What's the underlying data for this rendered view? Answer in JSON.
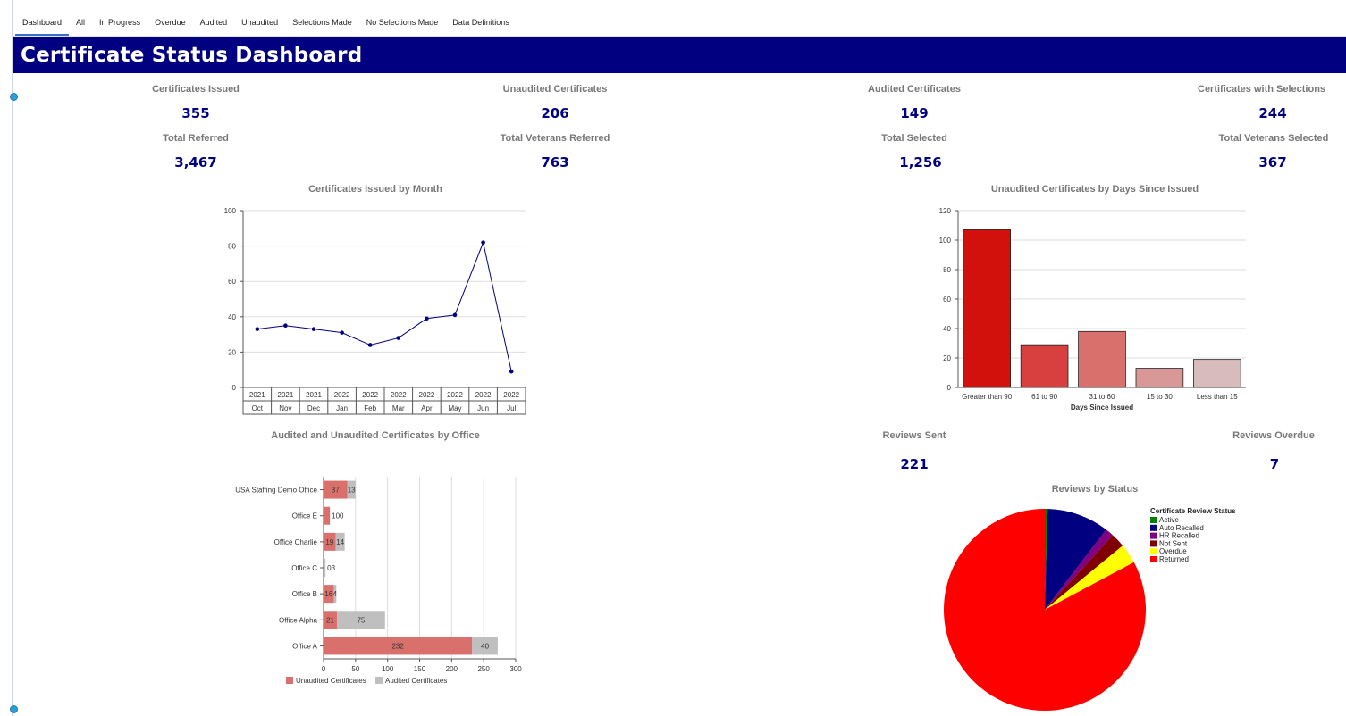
{
  "tabs": [
    "Dashboard",
    "All",
    "In Progress",
    "Overdue",
    "Audited",
    "Unaudited",
    "Selections Made",
    "No Selections Made",
    "Data Definitions"
  ],
  "banner": {
    "title": "Certificate Status Dashboard"
  },
  "kpis": {
    "certificates_issued": {
      "label": "Certificates Issued",
      "value": "355"
    },
    "unaudited_certificates": {
      "label": "Unaudited Certificates",
      "value": "206"
    },
    "audited_certificates": {
      "label": "Audited Certificates",
      "value": "149"
    },
    "certificates_with_selections": {
      "label": "Certificates with Selections",
      "value": "244"
    },
    "total_referred": {
      "label": "Total Referred",
      "value": "3,467"
    },
    "total_veterans_referred": {
      "label": "Total Veterans Referred",
      "value": "763"
    },
    "total_selected": {
      "label": "Total Selected",
      "value": "1,256"
    },
    "total_veterans_selected": {
      "label": "Total Veterans Selected",
      "value": "367"
    },
    "reviews_sent": {
      "label": "Reviews Sent",
      "value": "221"
    },
    "reviews_overdue": {
      "label": "Reviews Overdue",
      "value": "7"
    }
  },
  "colors": {
    "brand": "#000080",
    "line": "#000080",
    "unaudited": "#d9706c",
    "audited": "#bfbfbf"
  },
  "chart_data": [
    {
      "type": "line",
      "title": "Certificates Issued by Month",
      "years": [
        "2021",
        "2021",
        "2021",
        "2022",
        "2022",
        "2022",
        "2022",
        "2022",
        "2022",
        "2022"
      ],
      "categories": [
        "Oct",
        "Nov",
        "Dec",
        "Jan",
        "Feb",
        "Mar",
        "Apr",
        "May",
        "Jun",
        "Jul"
      ],
      "values": [
        33,
        35,
        33,
        31,
        24,
        28,
        39,
        41,
        82,
        9
      ],
      "ylim": [
        0,
        100
      ],
      "yticks": [
        0,
        20,
        40,
        60,
        80,
        100
      ],
      "grid": true
    },
    {
      "type": "bar",
      "title": "Unaudited Certificates by Days Since Issued",
      "categories": [
        "Greater than 90",
        "61 to 90",
        "31 to 60",
        "15 to 30",
        "Less than 15"
      ],
      "values": [
        107,
        29,
        38,
        13,
        19
      ],
      "colors": [
        "#d3110c",
        "#d84040",
        "#d9706c",
        "#d89898",
        "#d8bcbd"
      ],
      "xlabel": "Days Since Issued",
      "ylim": [
        0,
        120
      ],
      "yticks": [
        0,
        20,
        40,
        60,
        80,
        100,
        120
      ],
      "grid": true
    },
    {
      "type": "bar",
      "orientation": "horizontal",
      "stacked": true,
      "title": "Audited and Unaudited Certificates by Office",
      "categories": [
        "USA Staffing Demo Office",
        "Office E",
        "Office Charlie",
        "Office C",
        "Office B",
        "Office Alpha",
        "Office A"
      ],
      "series": [
        {
          "name": "Unaudited Certificates",
          "values": [
            37,
            10,
            19,
            0,
            16,
            21,
            232
          ],
          "labels": [
            "37",
            "",
            "19",
            "",
            "16",
            "21",
            "232"
          ]
        },
        {
          "name": "Audited Certificates",
          "values": [
            13,
            0,
            14,
            3,
            4,
            75,
            40
          ],
          "labels": [
            "13",
            "",
            "14",
            "",
            "4",
            "75",
            "40"
          ]
        }
      ],
      "outside_labels": [
        "",
        "100",
        "",
        "03",
        "",
        "",
        ""
      ],
      "xlim": [
        0,
        300
      ],
      "xticks": [
        0,
        50,
        100,
        150,
        200,
        250,
        300
      ],
      "legend": "bottom",
      "grid": true
    },
    {
      "type": "pie",
      "title": "Reviews by Status",
      "legend_title": "Certificate Review Status",
      "slices": [
        {
          "name": "Active",
          "value": 1,
          "color": "#008000"
        },
        {
          "name": "Auto Recalled",
          "value": 22,
          "color": "#000080"
        },
        {
          "name": "HR Recalled",
          "value": 3,
          "color": "#800080"
        },
        {
          "name": "Not Sent",
          "value": 5,
          "color": "#800000"
        },
        {
          "name": "Overdue",
          "value": 7,
          "color": "#ffff00"
        },
        {
          "name": "Returned",
          "value": 183,
          "color": "#ff0000"
        }
      ],
      "legend": "right"
    }
  ]
}
